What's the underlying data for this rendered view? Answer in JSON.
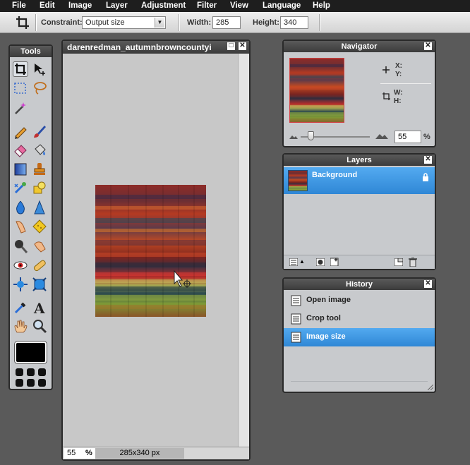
{
  "menu": [
    "File",
    "Edit",
    "Image",
    "Layer",
    "Adjustment",
    "Filter",
    "View",
    "Language",
    "Help"
  ],
  "options": {
    "constraint_label": "Constraint:",
    "constraint_value": "Output size",
    "width_label": "Width:",
    "width_value": "285",
    "height_label": "Height:",
    "height_value": "340"
  },
  "tools": {
    "title": "Tools"
  },
  "document": {
    "title": "darenredman_autumnbrowncountyi",
    "zoom": "55",
    "zoom_unit": "%",
    "dimensions": "285x340 px"
  },
  "navigator": {
    "title": "Navigator",
    "x_label": "X:",
    "y_label": "Y:",
    "w_label": "W:",
    "h_label": "H:",
    "zoom": "55",
    "zoom_unit": "%"
  },
  "layers": {
    "title": "Layers",
    "items": [
      {
        "name": "Background"
      }
    ]
  },
  "history": {
    "title": "History",
    "items": [
      {
        "label": "Open image"
      },
      {
        "label": "Crop tool"
      },
      {
        "label": "Image size"
      }
    ]
  },
  "colors": {
    "selection": "#3a95e0",
    "panel": "#c8cacd",
    "chrome": "#1e1e1e"
  }
}
